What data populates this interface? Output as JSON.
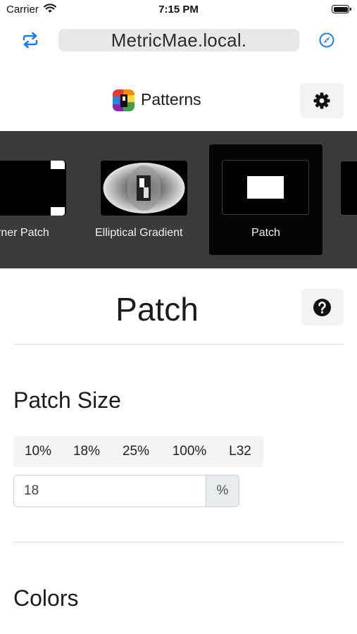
{
  "status_bar": {
    "carrier": "Carrier",
    "time": "7:15 PM"
  },
  "browser": {
    "url": "MetricMae.local."
  },
  "header": {
    "brand": "Patterns"
  },
  "carousel": {
    "items": [
      {
        "label": "rner Patch"
      },
      {
        "label": "Elliptical Gradient"
      },
      {
        "label": "Patch",
        "selected": true
      }
    ]
  },
  "main": {
    "title": "Patch",
    "patch_size": {
      "heading": "Patch Size",
      "presets": [
        "10%",
        "18%",
        "25%",
        "100%",
        "L32"
      ],
      "value": "18",
      "unit": "%"
    },
    "colors": {
      "heading": "Colors"
    }
  },
  "colors": {
    "accent": "#1a7cf2",
    "carousel_bg": "#3a3a3a"
  }
}
